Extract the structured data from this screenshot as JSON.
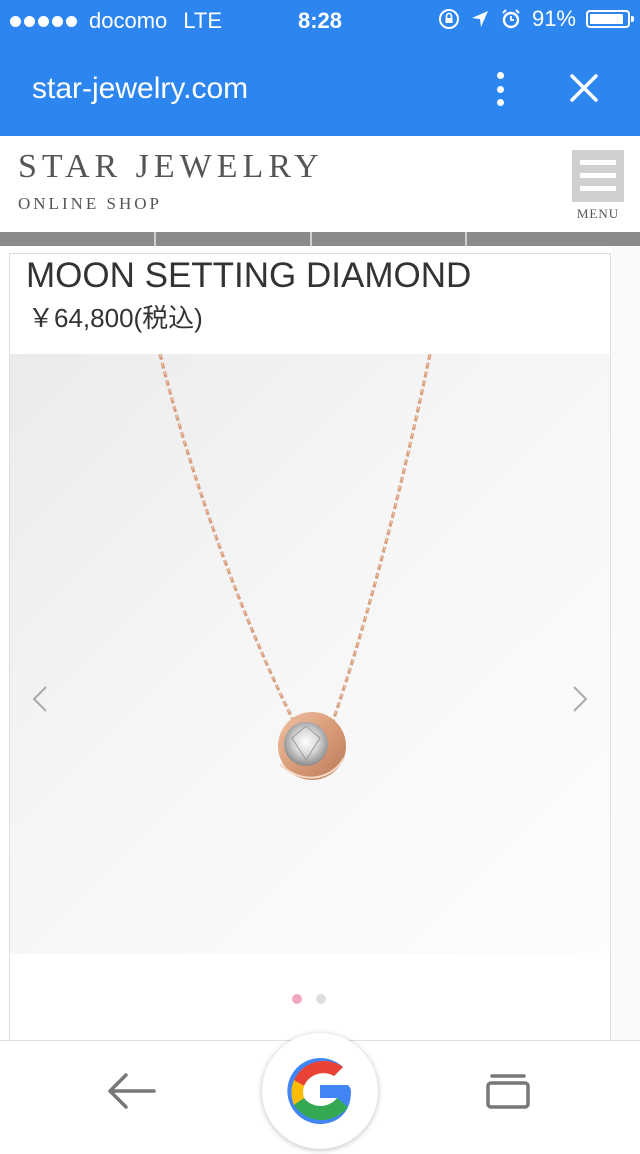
{
  "status_bar": {
    "carrier": "docomo",
    "network": "LTE",
    "time": "8:28",
    "battery": "91%",
    "battery_level": 0.91,
    "signal_bars": 5
  },
  "browser": {
    "url": "star-jewelry.com",
    "menu_icon": "vertical-dots-icon",
    "close_icon": "close-icon"
  },
  "site": {
    "logo_main": "STAR JEWELRY",
    "logo_sub": "ONLINE SHOP",
    "menu_label": "MENU"
  },
  "product": {
    "title": "MOON SETTING DIAMOND",
    "price": "￥64,800(税込)"
  },
  "carousel": {
    "active_index": 0,
    "count": 2,
    "active_color": "#f2a7c0",
    "inactive_color": "#dddddd"
  },
  "colors": {
    "browser_blue": "#2d86f0",
    "gold": "#dcA27c"
  },
  "bottom_nav": {
    "back_icon": "back-arrow-icon",
    "google_icon": "google-logo-icon",
    "tabs_icon": "tabs-icon"
  }
}
